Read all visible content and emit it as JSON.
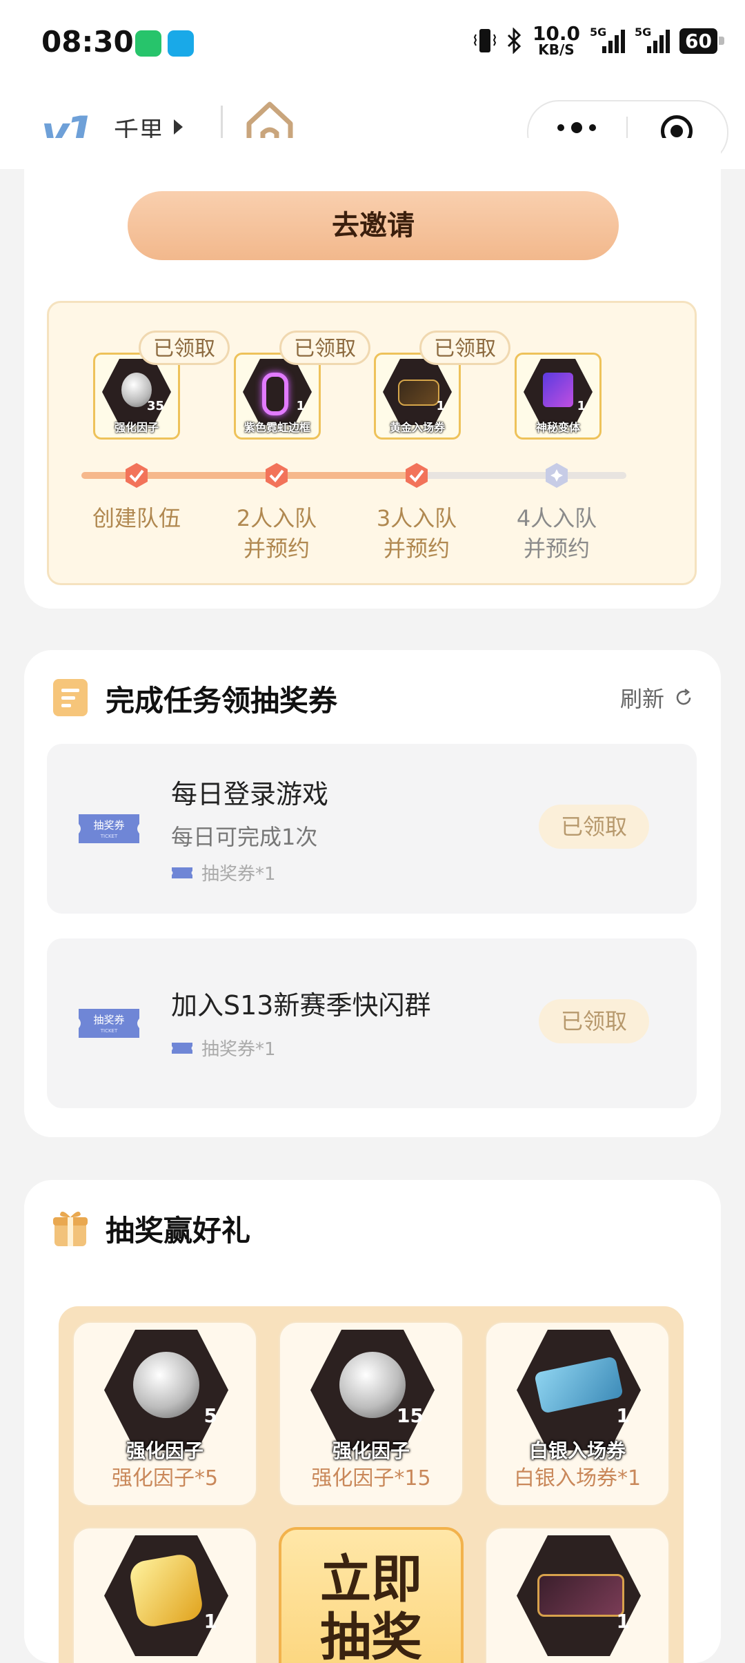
{
  "status_bar": {
    "time": "08:30",
    "net_speed_value": "10.0",
    "net_speed_unit": "KB/S",
    "signal1": "5G",
    "signal2": "5G",
    "battery": "60"
  },
  "nav": {
    "logo": "v1",
    "user_name": "千里"
  },
  "invite": {
    "button_label": "去邀请",
    "rewards": [
      {
        "name": "强化因子",
        "count": "35",
        "claimed_label": "已领取"
      },
      {
        "name": "紫色霓虹边框",
        "count": "1",
        "claimed_label": "已领取"
      },
      {
        "name": "黄金入场券",
        "count": "1",
        "claimed_label": "已领取"
      },
      {
        "name": "神秘变体",
        "count": "1",
        "claimed_label": ""
      }
    ],
    "steps": [
      {
        "line1": "创建队伍",
        "line2": ""
      },
      {
        "line1": "2人入队",
        "line2": "并预约"
      },
      {
        "line1": "3人入队",
        "line2": "并预约"
      },
      {
        "line1": "4人入队",
        "line2": "并预约"
      }
    ],
    "progress_completed_steps": 3
  },
  "tasks": {
    "title": "完成任务领抽奖券",
    "refresh_label": "刷新",
    "ticket_label": "抽奖券",
    "ticket_sub": "TICKET",
    "items": [
      {
        "title": "每日登录游戏",
        "subtitle": "每日可完成1次",
        "reward": "抽奖券*1",
        "status": "已领取"
      },
      {
        "title": "加入S13新赛季快闪群",
        "subtitle": "",
        "reward": "抽奖券*1",
        "status": "已领取"
      }
    ]
  },
  "lottery": {
    "title": "抽奖赢好礼",
    "draw_label_line1": "立即",
    "draw_label_line2": "抽奖",
    "prizes": [
      {
        "name": "强化因子",
        "count": "5",
        "label": "强化因子*5"
      },
      {
        "name": "强化因子",
        "count": "15",
        "label": "强化因子*15"
      },
      {
        "name": "白银入场券",
        "count": "1",
        "label": "白银入场券*1"
      },
      {
        "name": "",
        "count": "1",
        "label": ""
      },
      {
        "name": "",
        "count": "1",
        "label": ""
      }
    ]
  },
  "colors": {
    "accent": "#f2b88c",
    "gold_text": "#b08850",
    "claimed_bg": "#fbefd9"
  }
}
